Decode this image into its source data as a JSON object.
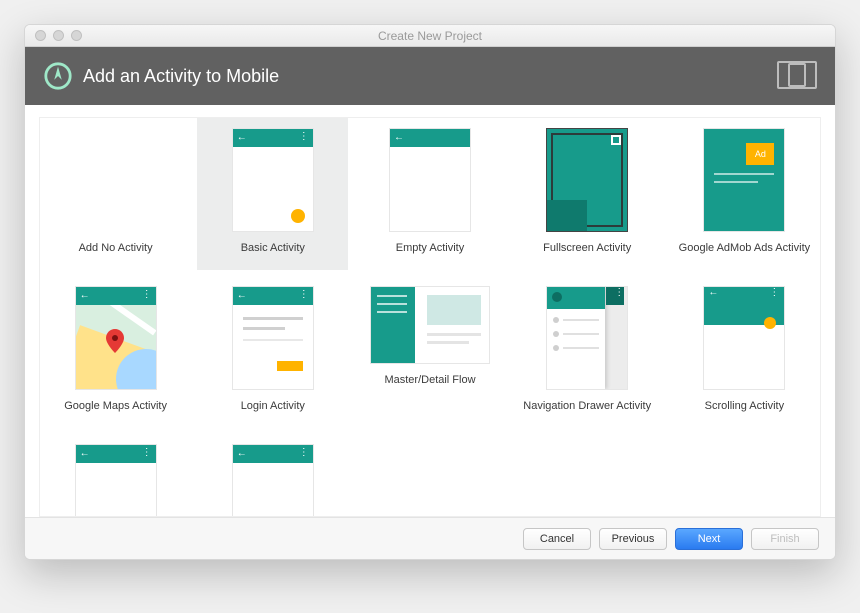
{
  "window": {
    "title": "Create New Project"
  },
  "header": {
    "title": "Add an Activity to Mobile"
  },
  "templates": [
    {
      "label": "Add No Activity"
    },
    {
      "label": "Basic Activity",
      "selected": true
    },
    {
      "label": "Empty Activity"
    },
    {
      "label": "Fullscreen Activity"
    },
    {
      "label": "Google AdMob Ads Activity"
    },
    {
      "label": "Google Maps Activity"
    },
    {
      "label": "Login Activity"
    },
    {
      "label": "Master/Detail Flow"
    },
    {
      "label": "Navigation Drawer Activity"
    },
    {
      "label": "Scrolling Activity"
    },
    {
      "label": ""
    },
    {
      "label": ""
    }
  ],
  "footer": {
    "cancel": "Cancel",
    "previous": "Previous",
    "next": "Next",
    "finish": "Finish"
  },
  "colors": {
    "teal": "#179b8b",
    "amber": "#ffb300"
  }
}
